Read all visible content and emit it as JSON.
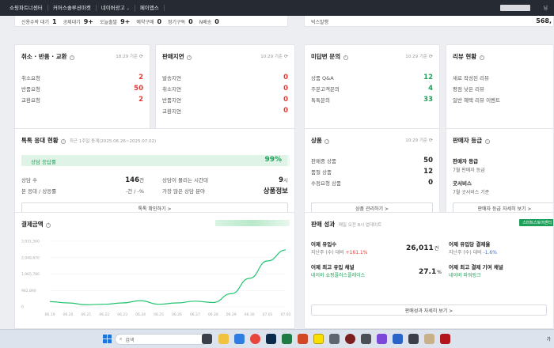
{
  "nav": {
    "items": [
      "쇼핑파트너센터",
      "커머스솔루션마켓",
      "네이버광고",
      "페이앱스"
    ],
    "chevron": "⌄",
    "user_tail": "님"
  },
  "top_strip": {
    "items": [
      {
        "label": "신용수락 대기",
        "value": "1"
      },
      {
        "label": "공제대기",
        "value": "9+"
      },
      {
        "label": "오늘출발",
        "value": "9+"
      },
      {
        "label": "예약구매",
        "value": "0"
      },
      {
        "label": "정기구독",
        "value": "0"
      },
      {
        "label": "N배송",
        "value": "0"
      }
    ],
    "right_label": "빅스발행",
    "right_value": "568,"
  },
  "cancel_card": {
    "title": "취소 · 반품 · 교환",
    "time": "18:29 기준",
    "rows": [
      {
        "label": "취소요청",
        "value": "2"
      },
      {
        "label": "반품요청",
        "value": "50"
      },
      {
        "label": "교환요청",
        "value": "2"
      }
    ]
  },
  "sales_delay_card": {
    "title": "판매지연",
    "time": "10:29 기준",
    "rows": [
      {
        "label": "발송지연",
        "value": "0"
      },
      {
        "label": "취소지연",
        "value": "0"
      },
      {
        "label": "반품지연",
        "value": "0"
      },
      {
        "label": "교환지연",
        "value": "0"
      }
    ]
  },
  "reply_card": {
    "title": "미답변 문의",
    "time": "10:29 기준",
    "rows": [
      {
        "label": "상품 Q&A",
        "value": "12"
      },
      {
        "label": "주문고객문의",
        "value": "4"
      },
      {
        "label": "톡톡문의",
        "value": "33"
      }
    ]
  },
  "review_card": {
    "title": "리뷰 현황",
    "rows": [
      "새로 작성된 리뷰",
      "평점 낮은 리뷰",
      "일반 혜택 리뷰 이벤트"
    ]
  },
  "talk_card": {
    "title": "톡톡 응대 현황",
    "subtitle": "최근 1주일 동계(2025.06.26~2025.07.02)",
    "bar_label": "상담 응답률",
    "bar_value": "99%",
    "bar_fill": 0.99,
    "left_rows": [
      {
        "label": "상담 수",
        "value": "146",
        "unit": "건"
      },
      {
        "label": "본 응대 / 상응률",
        "value": "-건 / -%",
        "unit": ""
      }
    ],
    "right_rows": [
      {
        "label": "상담이 몰리는 시간대",
        "value": "9",
        "unit": "시"
      },
      {
        "label": "가장 많은 상담 분야",
        "value": "상품정보",
        "unit": ""
      }
    ],
    "button": "톡톡 확인하기 >"
  },
  "product_card": {
    "title": "상품",
    "time": "10:29 기준",
    "rows": [
      {
        "label": "판매중 상품",
        "value": "50"
      },
      {
        "label": "품절 상품",
        "value": "12"
      },
      {
        "label": "수정요청 상품",
        "value": "0"
      }
    ],
    "button": "상품 관리하기 >"
  },
  "grade_card": {
    "title": "판매자 등급",
    "lines": [
      {
        "title": "판매자 등급",
        "desc": "7월 판매자 등급"
      },
      {
        "title": "굿서비스",
        "desc": "7월 굿서비스 기준"
      }
    ],
    "button": "판매자 등급 자세히 보기 >"
  },
  "payment_card": {
    "title": "결제금액"
  },
  "performance_card": {
    "title": "판매 성과",
    "subtitle": "매일 오전 8시 업데이트",
    "badge": "스마트스토어센터",
    "left_sections": [
      {
        "title": "어제 유입수",
        "sub_prefix": "지난주 (수) 대비",
        "change": "+161.1%",
        "value": "26,011",
        "unit": "건"
      },
      {
        "title": "어제 최고 유입 채널",
        "sub": "네이버 쇼핑플러스플레이스",
        "value": "27.1",
        "unit": "%"
      }
    ],
    "right_sections": [
      {
        "title": "어제 유입당 결제율",
        "sub_prefix": "지난주 (수) 대비",
        "change": "-1.6%"
      },
      {
        "title": "어제 최고 결제 기여 채널",
        "sub": "네이버 파워링크"
      }
    ],
    "button": "판매성과 자세히 보기 >"
  },
  "chart_data": {
    "type": "line",
    "x": [
      "06.19",
      "06.20",
      "06.21",
      "06.22",
      "06.23",
      "06.24",
      "06.25",
      "06.26",
      "06.27",
      "06.28",
      "06.29",
      "06.30",
      "07.01",
      "07.02"
    ],
    "series": [
      {
        "values": [
          120,
          90,
          50,
          60,
          90,
          140,
          60,
          90,
          130,
          100,
          300,
          650,
          1050,
          1300
        ]
      }
    ],
    "y_ticks": [
      "3,931,560",
      "2,948,670",
      "1,965,780",
      "982,890",
      "0"
    ],
    "ylim": [
      0,
      1500
    ],
    "color": "#22c36e"
  },
  "taskbar": {
    "search_placeholder": "검색",
    "time": "가"
  },
  "colors": {
    "accent_green": "#22c36e",
    "alert_red": "#e53935",
    "topbar": "#262a33"
  }
}
